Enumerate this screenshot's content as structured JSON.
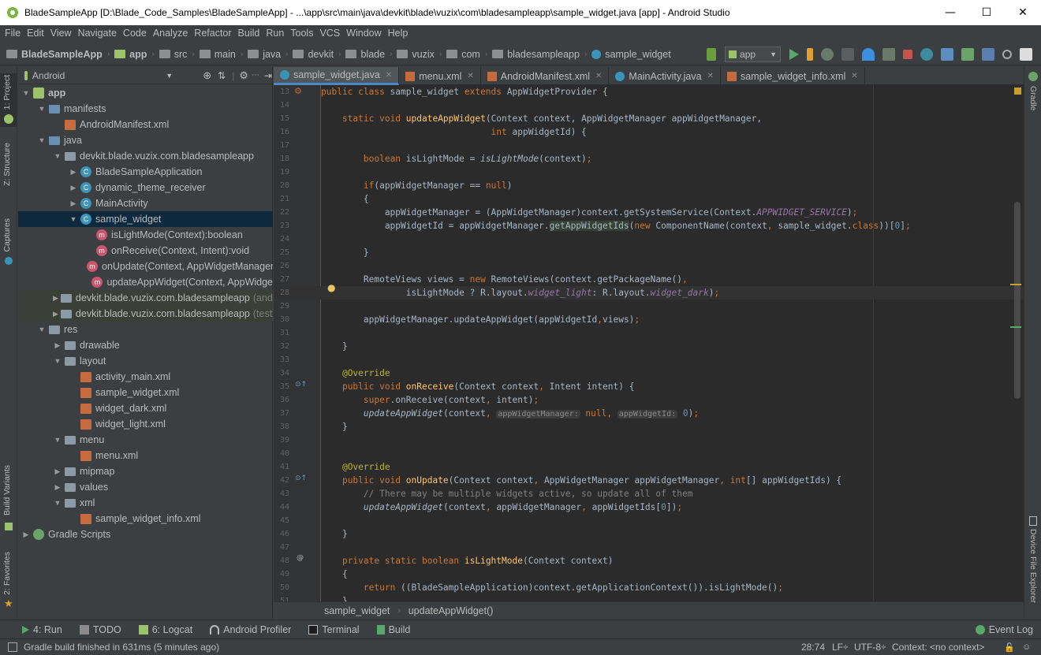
{
  "window": {
    "title": "BladeSampleApp [D:\\Blade_Code_Samples\\BladeSampleApp] - ...\\app\\src\\main\\java\\devkit\\blade\\vuzix\\com\\bladesampleapp\\sample_widget.java [app] - Android Studio",
    "minimize": "—",
    "maximize": "☐",
    "close": "✕"
  },
  "menu": [
    "File",
    "Edit",
    "View",
    "Navigate",
    "Code",
    "Analyze",
    "Refactor",
    "Build",
    "Run",
    "Tools",
    "VCS",
    "Window",
    "Help"
  ],
  "breadcrumbs": [
    "BladeSampleApp",
    "app",
    "src",
    "main",
    "java",
    "devkit",
    "blade",
    "vuzix",
    "com",
    "bladesampleapp",
    "sample_widget"
  ],
  "run_config": "app",
  "left_tabs": {
    "project": "1: Project",
    "structure": "Z: Structure",
    "captures": "Captures",
    "build_variants": "Build Variants",
    "favorites": "2: Favorites"
  },
  "right_tabs": {
    "gradle": "Gradle",
    "device_file_explorer": "Device File Explorer"
  },
  "project_panel": {
    "view": "Android",
    "tree": [
      {
        "label": "app",
        "indent": 0,
        "arrow": "▼",
        "icon": "andr"
      },
      {
        "label": "manifests",
        "indent": 1,
        "arrow": "▼",
        "icon": "folderb"
      },
      {
        "label": "AndroidManifest.xml",
        "indent": 2,
        "arrow": "",
        "icon": "xml"
      },
      {
        "label": "java",
        "indent": 1,
        "arrow": "▼",
        "icon": "folderb"
      },
      {
        "label": "devkit.blade.vuzix.com.bladesampleapp",
        "indent": 2,
        "arrow": "▼",
        "icon": "folder"
      },
      {
        "label": "BladeSampleApplication",
        "indent": 3,
        "arrow": "▶",
        "icon": "cls"
      },
      {
        "label": "dynamic_theme_receiver",
        "indent": 3,
        "arrow": "▶",
        "icon": "cls"
      },
      {
        "label": "MainActivity",
        "indent": 3,
        "arrow": "▶",
        "icon": "cls"
      },
      {
        "label": "sample_widget",
        "indent": 3,
        "arrow": "▼",
        "icon": "cls",
        "selected": true
      },
      {
        "label": "isLightMode(Context):boolean",
        "indent": 4,
        "arrow": "",
        "icon": "meth"
      },
      {
        "label": "onReceive(Context, Intent):void",
        "indent": 4,
        "arrow": "",
        "icon": "meth"
      },
      {
        "label": "onUpdate(Context, AppWidgetManager",
        "indent": 4,
        "arrow": "",
        "icon": "meth"
      },
      {
        "label": "updateAppWidget(Context, AppWidge",
        "indent": 4,
        "arrow": "",
        "icon": "meth"
      },
      {
        "label": "devkit.blade.vuzix.com.bladesampleapp",
        "suffix": "(andr",
        "indent": 2,
        "arrow": "▶",
        "icon": "folder",
        "highlight": true
      },
      {
        "label": "devkit.blade.vuzix.com.bladesampleapp",
        "suffix": "(test)",
        "indent": 2,
        "arrow": "▶",
        "icon": "folder",
        "highlight": true
      },
      {
        "label": "res",
        "indent": 1,
        "arrow": "▼",
        "icon": "folder"
      },
      {
        "label": "drawable",
        "indent": 2,
        "arrow": "▶",
        "icon": "folder"
      },
      {
        "label": "layout",
        "indent": 2,
        "arrow": "▼",
        "icon": "folder"
      },
      {
        "label": "activity_main.xml",
        "indent": 3,
        "arrow": "",
        "icon": "xml"
      },
      {
        "label": "sample_widget.xml",
        "indent": 3,
        "arrow": "",
        "icon": "xml"
      },
      {
        "label": "widget_dark.xml",
        "indent": 3,
        "arrow": "",
        "icon": "xml"
      },
      {
        "label": "widget_light.xml",
        "indent": 3,
        "arrow": "",
        "icon": "xml"
      },
      {
        "label": "menu",
        "indent": 2,
        "arrow": "▼",
        "icon": "folder"
      },
      {
        "label": "menu.xml",
        "indent": 3,
        "arrow": "",
        "icon": "xml"
      },
      {
        "label": "mipmap",
        "indent": 2,
        "arrow": "▶",
        "icon": "folder"
      },
      {
        "label": "values",
        "indent": 2,
        "arrow": "▶",
        "icon": "folder"
      },
      {
        "label": "xml",
        "indent": 2,
        "arrow": "▼",
        "icon": "folder"
      },
      {
        "label": "sample_widget_info.xml",
        "indent": 3,
        "arrow": "",
        "icon": "xml"
      },
      {
        "label": "Gradle Scripts",
        "indent": 0,
        "arrow": "▶",
        "icon": "gradle"
      }
    ]
  },
  "tabs": [
    {
      "label": "sample_widget.java",
      "active": true,
      "icon_color": "#3b93b8"
    },
    {
      "label": "menu.xml",
      "active": false,
      "icon_color": "#c66b3d"
    },
    {
      "label": "AndroidManifest.xml",
      "active": false,
      "icon_color": "#c66b3d"
    },
    {
      "label": "MainActivity.java",
      "active": false,
      "icon_color": "#3b93b8"
    },
    {
      "label": "sample_widget_info.xml",
      "active": false,
      "icon_color": "#c66b3d"
    }
  ],
  "editor_lines": [
    {
      "n": "13",
      "html": "<span class='kw'>public class </span>sample_widget <span class='kw'>extends </span>AppWidgetProvider {"
    },
    {
      "n": "14",
      "html": ""
    },
    {
      "n": "15",
      "html": "    <span class='kw'>static void </span><span class='fn'>updateAppWidget</span>(Context context, AppWidgetManager appWidgetManager,"
    },
    {
      "n": "16",
      "html": "                                <span class='kw'>int </span>appWidgetId) {"
    },
    {
      "n": "17",
      "html": ""
    },
    {
      "n": "18",
      "html": "        <span class='kw'>boolean </span>isLightMode = <span class='it'>isLightMode</span>(context)<span class='kw'>;</span>"
    },
    {
      "n": "19",
      "html": ""
    },
    {
      "n": "20",
      "html": "        <span class='kw'>if</span>(appWidgetManager == <span class='kw'>null</span>)"
    },
    {
      "n": "21",
      "html": "        {"
    },
    {
      "n": "22",
      "html": "            appWidgetManager = (AppWidgetManager)context.getSystemService(Context.<span class='cst'>APPWIDGET_SERVICE</span>)<span class='kw'>;</span>"
    },
    {
      "n": "23",
      "html": "            appWidgetId = appWidgetManager.<span class='warn'>getAppWidgetIds</span>(<span class='kw'>new </span>ComponentName(context<span class='kw'>, </span>sample_widget.<span class='kw'>class</span>))[<span class='nm'>0</span>]<span class='kw'>;</span>"
    },
    {
      "n": "24",
      "html": ""
    },
    {
      "n": "25",
      "html": "        }"
    },
    {
      "n": "26",
      "html": ""
    },
    {
      "n": "27",
      "html": "        RemoteViews views = <span class='kw'>new </span>RemoteViews(context.getPackageName()<span class='kw'>,</span>"
    },
    {
      "n": "28",
      "html": "                isLightMode ? R.layout.<span class='cst'>widget_light</span>: R.layout.<span class='cst'>widget_dark</span>)<span class='kw'>;</span>"
    },
    {
      "n": "29",
      "html": ""
    },
    {
      "n": "30",
      "html": "        appWidgetManager.updateAppWidget(appWidgetId<span class='kw'>,</span>views)<span class='kw'>;</span>"
    },
    {
      "n": "31",
      "html": ""
    },
    {
      "n": "32",
      "html": "    }"
    },
    {
      "n": "33",
      "html": ""
    },
    {
      "n": "34",
      "html": "    <span class='ann'>@Override</span>"
    },
    {
      "n": "35",
      "html": "    <span class='kw'>public void </span><span class='fn'>onReceive</span>(Context context<span class='kw'>, </span>Intent intent) {"
    },
    {
      "n": "36",
      "html": "        <span class='kw'>super</span>.onReceive(context<span class='kw'>, </span>intent)<span class='kw'>;</span>"
    },
    {
      "n": "37",
      "html": "        <span class='it'>updateAppWidget</span>(context<span class='kw'>, </span><span class='hint'>appWidgetManager:</span> <span class='kw'>null</span><span class='kw'>, </span><span class='hint'>appWidgetId:</span> <span class='nm'>0</span>)<span class='kw'>;</span>"
    },
    {
      "n": "38",
      "html": "    }"
    },
    {
      "n": "39",
      "html": ""
    },
    {
      "n": "40",
      "html": ""
    },
    {
      "n": "41",
      "html": "    <span class='ann'>@Override</span>"
    },
    {
      "n": "42",
      "html": "    <span class='kw'>public void </span><span class='fn'>onUpdate</span>(Context context<span class='kw'>, </span>AppWidgetManager appWidgetManager<span class='kw'>, int</span>[] appWidgetIds) {"
    },
    {
      "n": "43",
      "html": "        <span class='cm'>// There may be multiple widgets active, so update all of them</span>"
    },
    {
      "n": "44",
      "html": "        <span class='it'>updateAppWidget</span>(context<span class='kw'>, </span>appWidgetManager<span class='kw'>, </span>appWidgetIds[<span class='nm'>0</span>])<span class='kw'>;</span>"
    },
    {
      "n": "45",
      "html": ""
    },
    {
      "n": "46",
      "html": "    }"
    },
    {
      "n": "47",
      "html": ""
    },
    {
      "n": "48",
      "html": "    <span class='kw'>private static boolean </span><span class='fn'>isLightMode</span>(Context context)"
    },
    {
      "n": "49",
      "html": "    {"
    },
    {
      "n": "50",
      "html": "        <span class='kw'>return </span>((BladeSampleApplication)context.getApplicationContext()).isLightMode()<span class='kw'>;</span>"
    },
    {
      "n": "51",
      "html": "    }"
    }
  ],
  "editor_crumbs": {
    "class": "sample_widget",
    "method": "updateAppWidget()"
  },
  "bottom_tools": [
    "4: Run",
    "TODO",
    "6: Logcat",
    "Android Profiler",
    "Terminal",
    "Build"
  ],
  "event_log": "Event Log",
  "status": {
    "message": "Gradle build finished in 631ms (5 minutes ago)",
    "position": "28:74",
    "line_sep": "LF÷",
    "encoding": "UTF-8÷",
    "context": "Context: <no context>"
  },
  "colors": {
    "accent": "#4a88c7",
    "editor_bg": "#2b2b2b",
    "panel_bg": "#3c3f41"
  }
}
